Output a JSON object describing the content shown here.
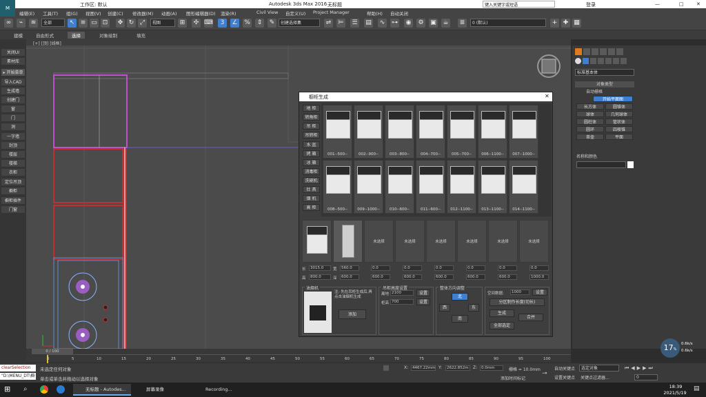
{
  "window": {
    "title": "Autodesk 3ds Max 2016",
    "file": "无标题",
    "workspace": "工作区: 默认",
    "search_placeholder": "键入关键字或短语",
    "login": "登录"
  },
  "menu": [
    "编辑(E)",
    "工具(T)",
    "组(G)",
    "视图(V)",
    "创建(C)",
    "修改器(M)",
    "动画(A)",
    "图形编辑器(D)",
    "渲染(R)",
    "Civil View",
    "自定义(U)",
    "Project Manager",
    "帮助(H)",
    "自动关闭"
  ],
  "toolbar": {
    "filter": "全部",
    "view": "视图",
    "selection_set": "创建选择集",
    "layer": "0 (默认)"
  },
  "ribbon": {
    "tabs": [
      "建模",
      "自由形式",
      "选择",
      "对象绘制",
      "填充"
    ],
    "active": "选择"
  },
  "viewport": {
    "label": "[+] [顶] [线框]"
  },
  "left_panel": {
    "top": [
      "关闭UI",
      "素材库"
    ],
    "header": "▸ 开始菜单",
    "items": [
      "导入CAD",
      "生成墙",
      "创建门",
      "窗",
      "门",
      "洞",
      "一字墙",
      "封顶",
      "楼层",
      "楼梯",
      "衣柜",
      "定位吊顶",
      "橱柜",
      "橱柜插件",
      "门窗"
    ]
  },
  "dialog": {
    "title": "橱柜生成",
    "categories": [
      "地 柜",
      "转角柜",
      "吊 柜",
      "吊转柜",
      "水 盆",
      "烤 箱",
      "冰 箱",
      "消毒柜",
      "洗碗机",
      "灶 具",
      "烟 机",
      "高 柜",
      "消毒柜"
    ],
    "row1": [
      "001--500--",
      "002--900--",
      "003--800--",
      "004--700--",
      "005--700--",
      "006--1100--",
      "007--1000--"
    ],
    "row2": [
      "008--500--",
      "009--1000--",
      "010--600--",
      "011--600--",
      "012--1100--",
      "013--1100--",
      "014--1100--"
    ],
    "slots_empty": "未选择",
    "dims": {
      "long_label": "长",
      "long_val": "3015.0",
      "w_label": "宽",
      "w_val": "560.0",
      "h_label": "高",
      "h_val": "800.0",
      "d_label": "深",
      "d_val": "0.0",
      "other": "0.0",
      "other2": "600.0",
      "other3": "1000.0"
    },
    "hood_group": {
      "title": "油烟机",
      "text": "注: 先在吊柜生成后,再点击油烟机生成",
      "button": "添加"
    },
    "space_group": {
      "title": "吊柜高度设置",
      "label1": "离地",
      "val1": "2100",
      "label2": "柜高",
      "val2": "700",
      "button": "设置"
    },
    "direction_group": {
      "title": "整体方向调整",
      "up": "北",
      "left": "西",
      "right": "东",
      "down": "南"
    },
    "right_group": {
      "label": "空间数据:",
      "value": "1000",
      "set": "设置",
      "split": "分区制作长度(切长)",
      "gen": "生成",
      "merge": "合并",
      "all": "全部选定"
    }
  },
  "command_panel": {
    "dropdown": "标准基本体",
    "section": "对象类型",
    "auto_grid": "自动栅格",
    "items": [
      "开始平面图",
      "长方体",
      "圆锥体",
      "球体",
      "几何球体",
      "圆柱体",
      "管状体",
      "圆环",
      "四棱锥",
      "茶壶",
      "平面"
    ],
    "name_section": "名称和颜色"
  },
  "timeline": {
    "frame": "0 / 100",
    "ticks": [
      "0",
      "5",
      "10",
      "15",
      "20",
      "25",
      "30",
      "35",
      "40",
      "45",
      "50",
      "55",
      "60",
      "65",
      "70",
      "75",
      "80",
      "85",
      "90",
      "95",
      "100"
    ]
  },
  "status": {
    "maxscript": "clearSelection",
    "path": "\"D:\\MENU_DT\\橱",
    "line1": "未选定任何对象",
    "line2": "单击或单击并拖动以选择对象",
    "x": "4467.22mm",
    "y": "2622.852m",
    "z": "0.0mm",
    "grid": "栅格 = 10.0mm",
    "add_time": "添加时间标记",
    "auto_key": "自动关键点",
    "selected": "选定对象",
    "set_key": "设置关键点",
    "key_filter": "关键点过滤器..."
  },
  "taskbar": {
    "apps": [
      "无标题 - Autodes...",
      "屏幕录像",
      "Recording..."
    ],
    "time": "18:39",
    "date": "2021/5/19"
  },
  "fps": {
    "value": "17",
    "unit": "%",
    "up": "0.6k/s",
    "down": "0.6k/s"
  }
}
